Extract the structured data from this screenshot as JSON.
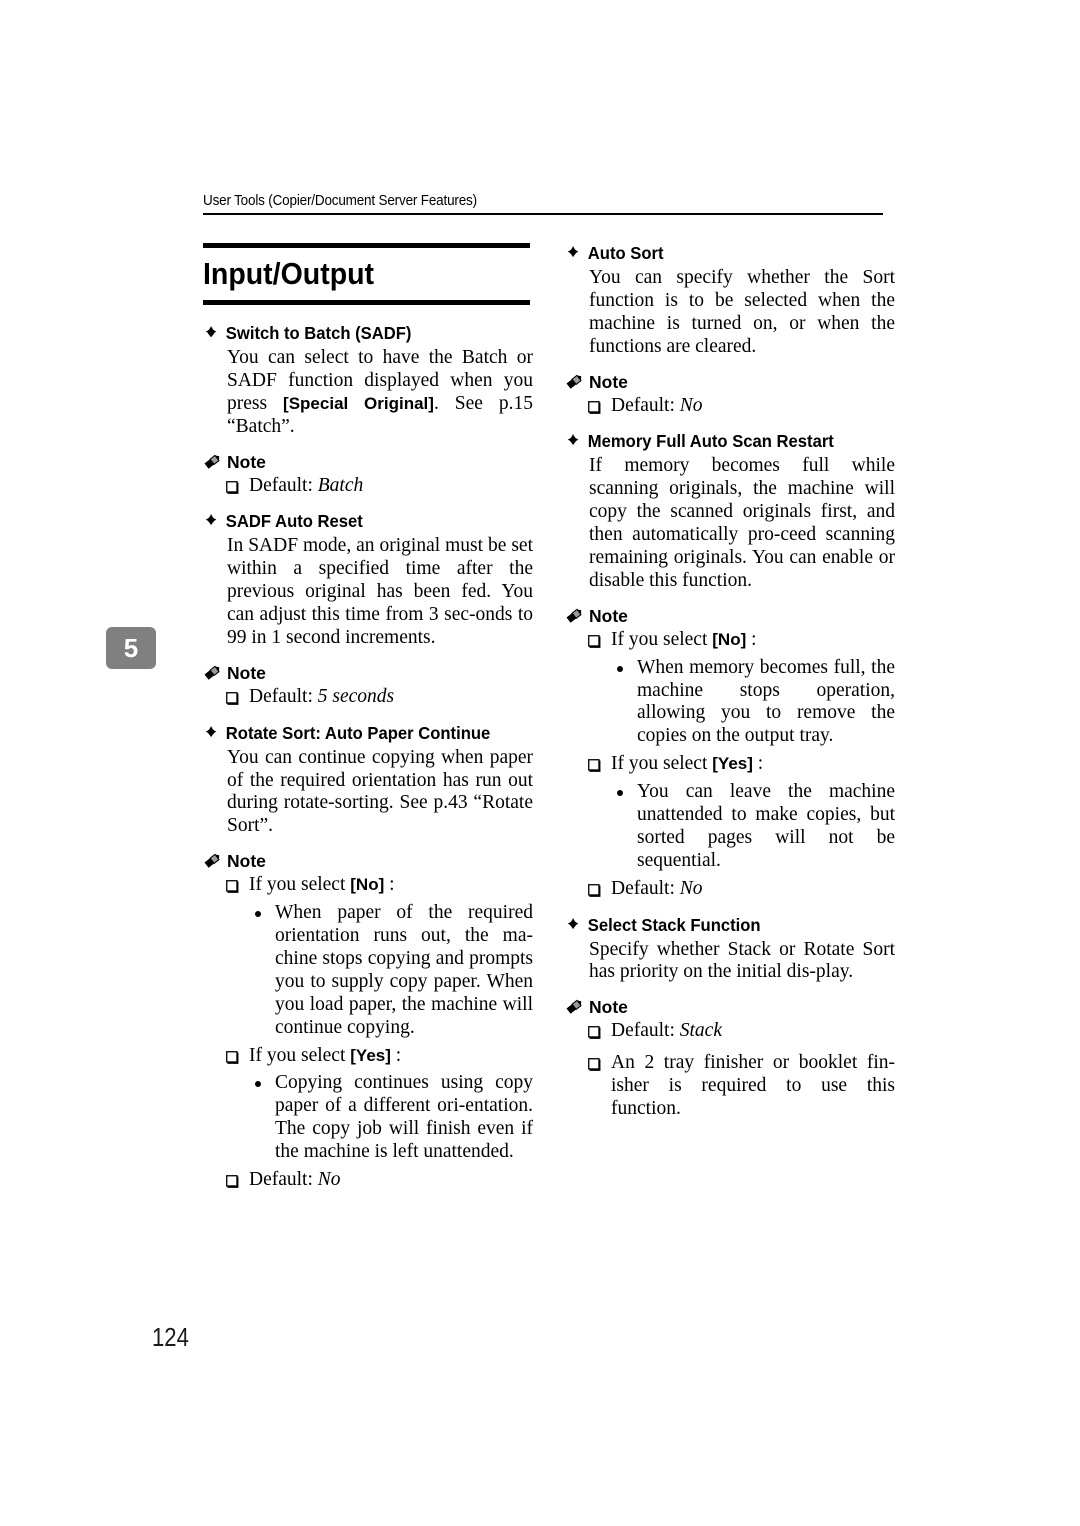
{
  "header": {
    "running_title": "User Tools (Copier/Document Server Features)"
  },
  "chapter_tab": {
    "number": "5"
  },
  "page_number": "124",
  "section": {
    "title": "Input/Output"
  },
  "labels": {
    "note": "Note",
    "default_prefix": "Default:",
    "diamond_icon": "diamond-bullet-icon",
    "pencil_icon": "pencil-note-icon",
    "checkbox_icon": "checkbox-bullet-icon",
    "round_bullet_icon": "round-bullet-icon"
  },
  "left_column": {
    "items": [
      {
        "heading": "Switch to Batch (SADF)",
        "body_pre": "You can select to have the Batch or SADF function displayed when you press ",
        "body_term": "[Special Original]",
        "body_post": ". See p.15 “Batch”.",
        "note_label": "Note",
        "note_entries": [
          {
            "text_pre": "Default: ",
            "text_italic": "Batch",
            "text_post": ""
          }
        ]
      },
      {
        "heading": "SADF Auto Reset",
        "body": "In SADF mode, an original must be set within a specified time after the previous original has been fed. You can adjust this time from 3 sec-onds to 99 in 1 second increments.",
        "note_label": "Note",
        "note_entries": [
          {
            "text_pre": "Default: ",
            "text_italic": "5 seconds",
            "text_post": ""
          }
        ]
      },
      {
        "heading": "Rotate Sort: Auto Paper Continue",
        "body": "You can continue copying when paper of the required orientation has run out during rotate-sorting. See p.43 “Rotate Sort”.",
        "note_label": "Note",
        "note_entries": [
          {
            "text_pre": "If you select ",
            "term": "[No]",
            "text_post": " :",
            "bullets": [
              "When paper of the required orientation runs out, the ma-chine stops copying and prompts you to supply copy paper. When you load paper, the machine will continue copying."
            ]
          },
          {
            "text_pre": "If you select ",
            "term": "[Yes]",
            "text_post": " :",
            "bullets": [
              "Copying continues using copy paper of a different ori-entation. The copy job will finish even if the machine is left unattended."
            ]
          },
          {
            "text_pre": "Default: ",
            "text_italic": "No",
            "text_post": ""
          }
        ]
      }
    ]
  },
  "right_column": {
    "items": [
      {
        "heading": "Auto Sort",
        "body": "You can specify whether the Sort function is to be selected when the machine is turned on, or when the functions are cleared.",
        "note_label": "Note",
        "note_entries": [
          {
            "text_pre": "Default: ",
            "text_italic": "No",
            "text_post": ""
          }
        ]
      },
      {
        "heading": "Memory Full Auto Scan Restart",
        "body": "If memory becomes full while scanning originals, the machine will copy the scanned originals first, and then automatically pro-ceed scanning remaining originals. You can enable or disable this function.",
        "note_label": "Note",
        "note_entries": [
          {
            "text_pre": "If you select ",
            "term": "[No]",
            "text_post": " :",
            "bullets": [
              "When memory becomes full, the machine stops operation, allowing you to remove the copies on the output tray."
            ]
          },
          {
            "text_pre": "If you select ",
            "term": "[Yes]",
            "text_post": " :",
            "bullets": [
              "You can leave the machine unattended to make copies, but sorted pages will not be sequential."
            ]
          },
          {
            "text_pre": "Default: ",
            "text_italic": "No",
            "text_post": ""
          }
        ]
      },
      {
        "heading": "Select Stack Function",
        "body": "Specify whether Stack or Rotate Sort has priority on the initial dis-play.",
        "note_label": "Note",
        "note_entries": [
          {
            "text_pre": "Default: ",
            "text_italic": "Stack",
            "text_post": ""
          },
          {
            "text_pre": "An 2 tray finisher or booklet fin-isher is required to use this function.",
            "text_italic": "",
            "text_post": ""
          }
        ]
      }
    ]
  }
}
